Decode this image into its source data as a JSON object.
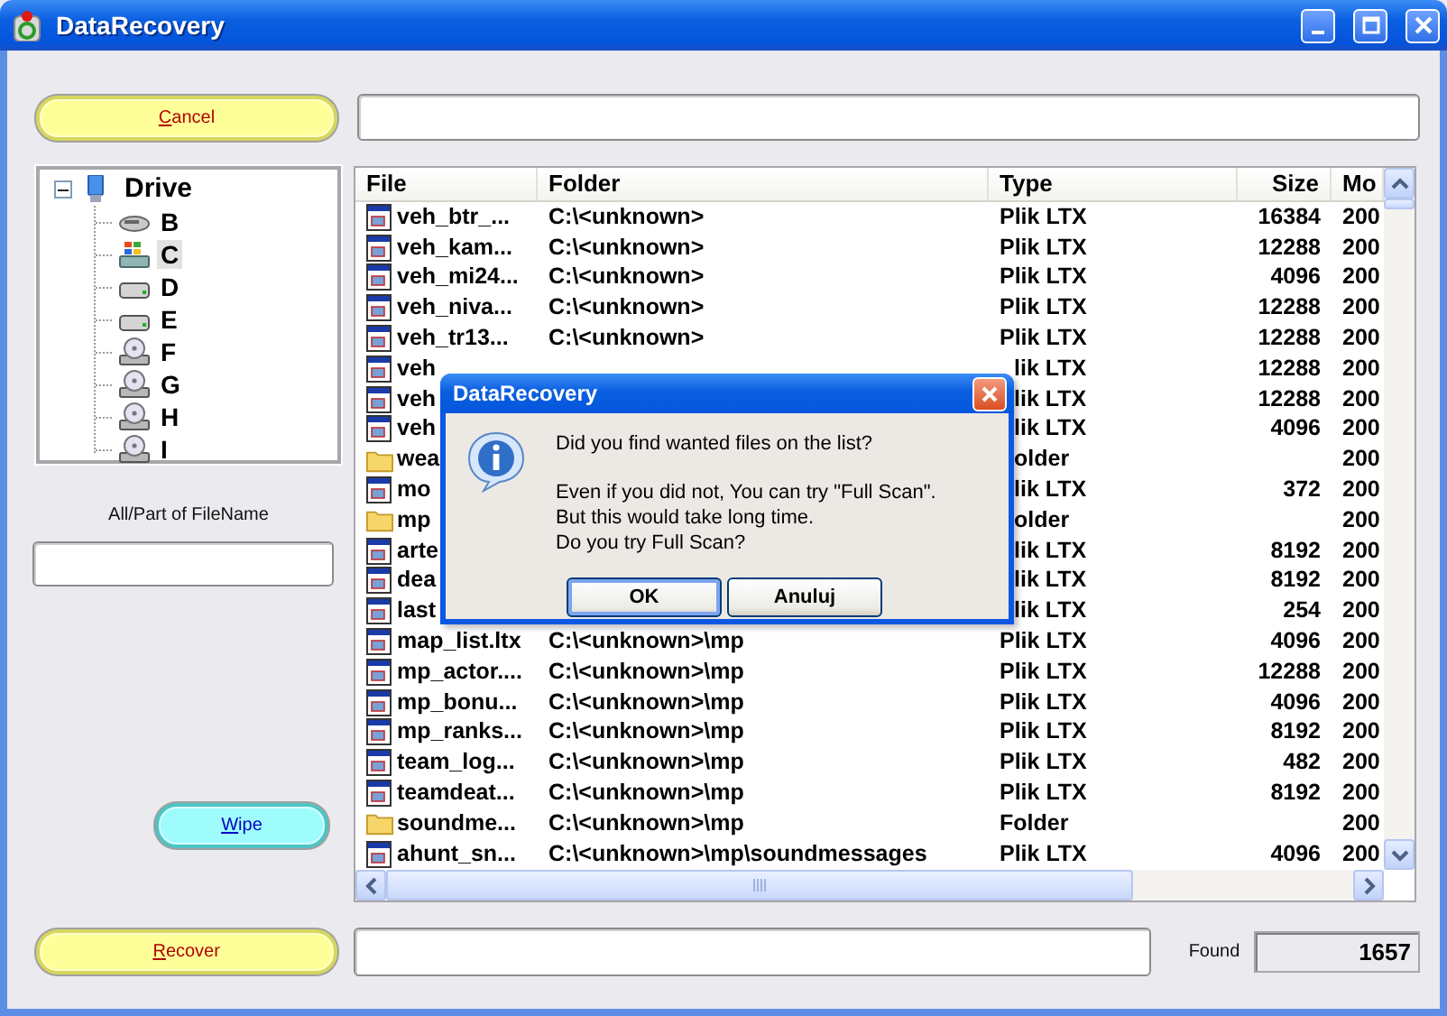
{
  "window": {
    "title": "DataRecovery"
  },
  "cancel_button": "Cancel",
  "drive_tree": {
    "label": "Drive",
    "expanded": true,
    "children": [
      {
        "label": "B",
        "kind": "removable",
        "selected": false
      },
      {
        "label": "C",
        "kind": "system",
        "selected": true
      },
      {
        "label": "D",
        "kind": "disk",
        "selected": false
      },
      {
        "label": "E",
        "kind": "disk",
        "selected": false
      },
      {
        "label": "F",
        "kind": "cd",
        "selected": false
      },
      {
        "label": "G",
        "kind": "cd",
        "selected": false
      },
      {
        "label": "H",
        "kind": "cd",
        "selected": false
      },
      {
        "label": "I",
        "kind": "cd",
        "selected": false
      }
    ]
  },
  "filename_filter": {
    "label": "All/Part of FileName"
  },
  "wipe_button": "Wipe",
  "file_list": {
    "columns": [
      "File",
      "Folder",
      "Type",
      "Size",
      "Mo"
    ],
    "rows": [
      {
        "kind": "file",
        "covered": false,
        "file": "veh_btr_...",
        "folder": "C:\\<unknown>",
        "type": "Plik LTX",
        "size": "16384",
        "modified": "200"
      },
      {
        "kind": "file",
        "covered": false,
        "file": "veh_kam...",
        "folder": "C:\\<unknown>",
        "type": "Plik LTX",
        "size": "12288",
        "modified": "200"
      },
      {
        "kind": "file",
        "covered": false,
        "file": "veh_mi24...",
        "folder": "C:\\<unknown>",
        "type": "Plik LTX",
        "size": "4096",
        "modified": "200"
      },
      {
        "kind": "file",
        "covered": false,
        "file": "veh_niva...",
        "folder": "C:\\<unknown>",
        "type": "Plik LTX",
        "size": "12288",
        "modified": "200"
      },
      {
        "kind": "file",
        "covered": false,
        "file": "veh_tr13...",
        "folder": "C:\\<unknown>",
        "type": "Plik LTX",
        "size": "12288",
        "modified": "200"
      },
      {
        "kind": "file",
        "covered": true,
        "file": "veh",
        "type": "lik LTX",
        "size": "12288",
        "modified": "200"
      },
      {
        "kind": "file",
        "covered": true,
        "file": "veh",
        "type": "lik LTX",
        "size": "12288",
        "modified": "200"
      },
      {
        "kind": "file",
        "covered": true,
        "file": "veh",
        "type": "lik LTX",
        "size": "4096",
        "modified": "200"
      },
      {
        "kind": "folder",
        "covered": true,
        "file": "wea",
        "type": "older",
        "modified": "200"
      },
      {
        "kind": "file",
        "covered": true,
        "file": "mo",
        "type": "lik LTX",
        "size": "372",
        "modified": "200"
      },
      {
        "kind": "folder",
        "covered": true,
        "file": "mp",
        "type": "older",
        "modified": "200"
      },
      {
        "kind": "file",
        "covered": true,
        "file": "arte",
        "type": "lik LTX",
        "size": "8192",
        "modified": "200"
      },
      {
        "kind": "file",
        "covered": true,
        "file": "dea",
        "type": "lik LTX",
        "size": "8192",
        "modified": "200"
      },
      {
        "kind": "file",
        "covered": true,
        "file": "last",
        "type": "lik LTX",
        "size": "254",
        "modified": "200"
      },
      {
        "kind": "file",
        "covered": false,
        "file": "map_list.ltx",
        "folder": "C:\\<unknown>\\mp",
        "type": "Plik LTX",
        "size": "4096",
        "modified": "200"
      },
      {
        "kind": "file",
        "covered": false,
        "file": "mp_actor....",
        "folder": "C:\\<unknown>\\mp",
        "type": "Plik LTX",
        "size": "12288",
        "modified": "200"
      },
      {
        "kind": "file",
        "covered": false,
        "file": "mp_bonu...",
        "folder": "C:\\<unknown>\\mp",
        "type": "Plik LTX",
        "size": "4096",
        "modified": "200"
      },
      {
        "kind": "file",
        "covered": false,
        "file": "mp_ranks...",
        "folder": "C:\\<unknown>\\mp",
        "type": "Plik LTX",
        "size": "8192",
        "modified": "200"
      },
      {
        "kind": "file",
        "covered": false,
        "file": "team_log...",
        "folder": "C:\\<unknown>\\mp",
        "type": "Plik LTX",
        "size": "482",
        "modified": "200"
      },
      {
        "kind": "file",
        "covered": false,
        "file": "teamdeat...",
        "folder": "C:\\<unknown>\\mp",
        "type": "Plik LTX",
        "size": "8192",
        "modified": "200"
      },
      {
        "kind": "folder",
        "covered": false,
        "file": "soundme...",
        "folder": "C:\\<unknown>\\mp",
        "type": "Folder",
        "modified": "200"
      },
      {
        "kind": "file",
        "covered": false,
        "file": "ahunt_sn...",
        "folder": "C:\\<unknown>\\mp\\soundmessages",
        "type": "Plik LTX",
        "size": "4096",
        "modified": "200"
      }
    ]
  },
  "dialog": {
    "title": "DataRecovery",
    "paragraphs": [
      "Did you find wanted files on the list?",
      "Even if you did not, You can try \"Full Scan\".\nBut this would take long time.\nDo you try Full Scan?"
    ],
    "buttons": [
      {
        "label": "OK",
        "selected": true
      },
      {
        "label": "Anuluj",
        "selected": false
      }
    ]
  },
  "recover_button": "Recover",
  "status": {
    "label": "Found",
    "value": "1657"
  }
}
